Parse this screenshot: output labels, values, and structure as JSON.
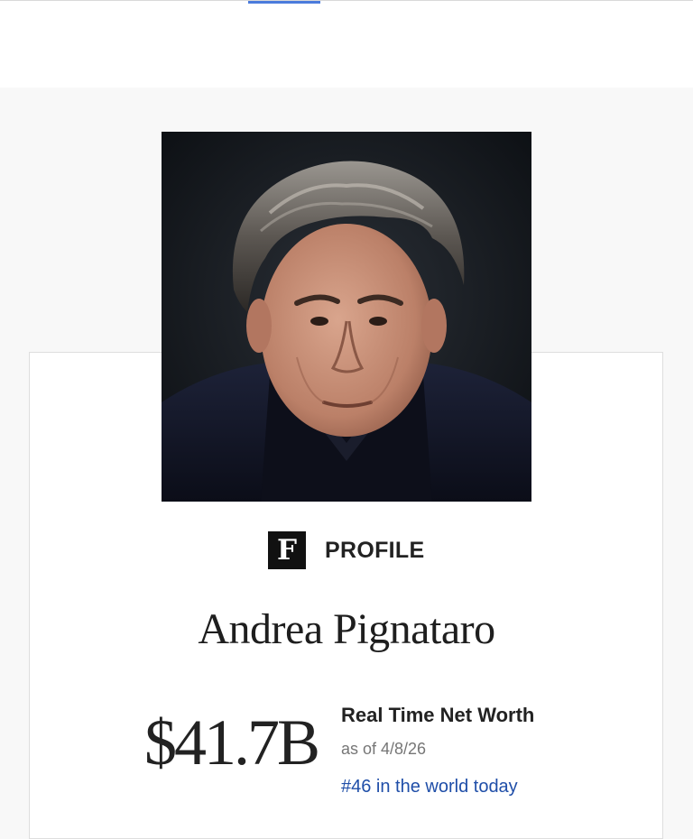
{
  "header": {
    "active_tab_color": "#4b7bdc"
  },
  "profile": {
    "photo_alt": "Andrea Pignataro",
    "brand_logo_letter": "F",
    "brand_label": "PROFILE",
    "name": "Andrea Pignataro",
    "net_worth": "$41.7B",
    "net_worth_title": "Real Time Net Worth",
    "as_of": "as of 4/8/26",
    "rank": "#46 in the world today"
  }
}
